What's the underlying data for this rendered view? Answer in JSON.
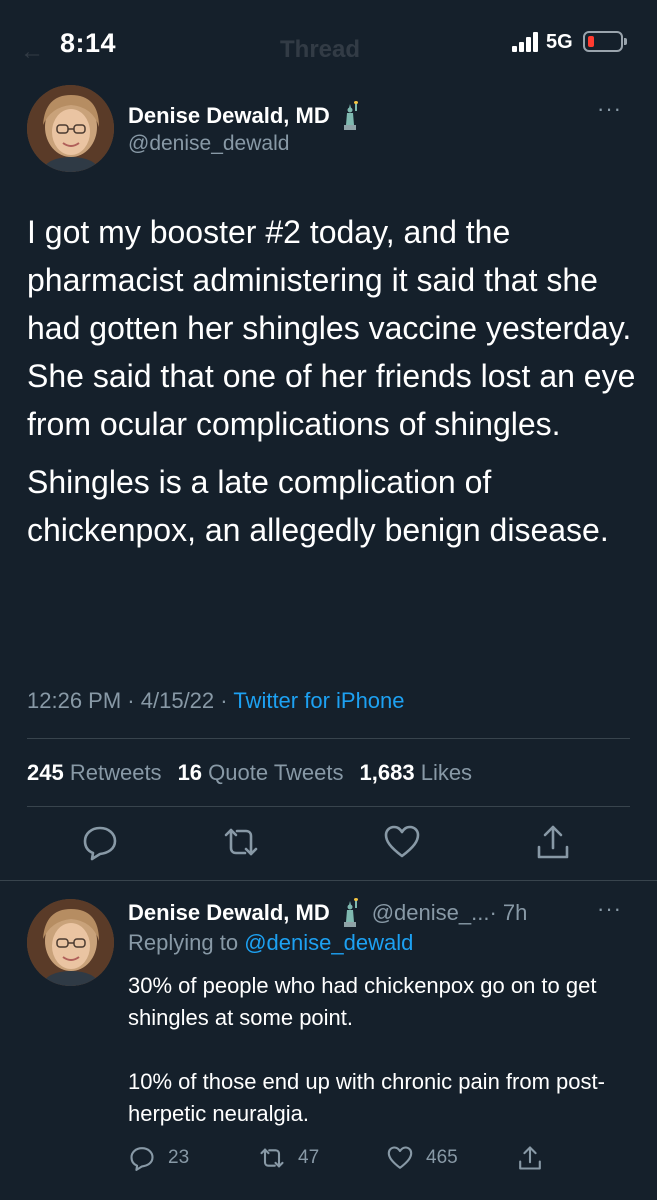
{
  "status_bar": {
    "time": "8:14",
    "network": "5G"
  },
  "header": {
    "back_glyph": "←",
    "title": "Thread"
  },
  "main_tweet": {
    "author_name": "Denise Dewald, MD",
    "author_handle": "@denise_dewald",
    "author_emoji_icon": "statue-of-liberty-icon",
    "body": [
      "I got my booster #2 today, and the pharmacist administering it said that she had gotten her shingles vaccine yesterday. She said that one of her friends lost an eye from ocular complications of shingles.",
      "Shingles is a late complication of chickenpox, an allegedly benign disease."
    ],
    "time": "12:26 PM",
    "date": "4/15/22",
    "separator": "·",
    "source": "Twitter for iPhone",
    "stats": {
      "retweets_count": "245",
      "retweets_label": "Retweets",
      "quotes_count": "16",
      "quotes_label": "Quote Tweets",
      "likes_count": "1,683",
      "likes_label": "Likes"
    },
    "more_glyph": "···",
    "actions": [
      "reply-icon",
      "retweet-icon",
      "like-icon",
      "share-icon"
    ]
  },
  "reply_tweet": {
    "author_name": "Denise Dewald, MD",
    "author_handle": "@denise_...",
    "time": "· 7h",
    "replying_prefix": "Replying to",
    "replying_to": "@denise_dewald",
    "body": [
      "30% of people who had chickenpox go on to get shingles at some point.",
      "10% of those end up with chronic pain from post-herpetic neuralgia."
    ],
    "counts": {
      "replies": "23",
      "retweets": "47",
      "likes": "465"
    },
    "more_glyph": "···"
  },
  "colors": {
    "background": "#15202b",
    "text": "#ffffff",
    "secondary": "#8899a6",
    "accent": "#1da1f2",
    "divider": "#38444d",
    "battery_low": "#ff3b30"
  }
}
